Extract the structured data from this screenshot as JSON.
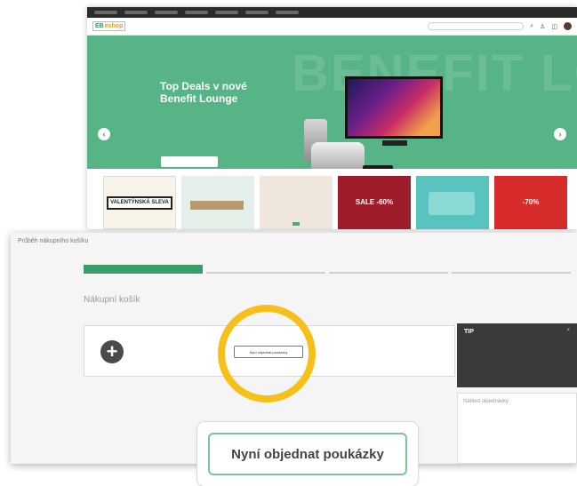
{
  "browser": {
    "tabs": [
      "",
      "",
      "",
      "",
      "",
      "",
      ""
    ],
    "logo": {
      "main": "EB",
      "accent": "eshop"
    },
    "nav_links": [
      "",
      "",
      "",
      "",
      "",
      ""
    ],
    "search_placeholder": ""
  },
  "hero": {
    "title_line1": "Top Deals v nové",
    "title_line2": "Benefit Lounge",
    "subtitle": "",
    "cta": "",
    "background_text": "BENEFIT LOUNGE",
    "prev_arrow": "‹",
    "next_arrow": "›",
    "accent_color": "#57b487"
  },
  "promo_tiles": [
    {
      "name": "valentine",
      "text": "VALENTÝNSKÁ SLEVA"
    },
    {
      "name": "shelf",
      "text": ""
    },
    {
      "name": "fashion",
      "text": ""
    },
    {
      "name": "sale",
      "text": "SALE -60%"
    },
    {
      "name": "teal",
      "text": ""
    },
    {
      "name": "discount",
      "text": "-70%"
    }
  ],
  "checkout": {
    "window_title": "Průběh nákupního košíku",
    "steps": [
      "",
      "",
      "",
      ""
    ],
    "active_step": 1,
    "cart_heading": "Nákupní košík",
    "column_left": "",
    "column_right": "",
    "add_icon": "plus-icon",
    "order_small_button": "Nyní objednat poukázky",
    "note": "",
    "tip": {
      "heading": "TIP",
      "close": "×",
      "text": ""
    },
    "summary": {
      "heading": "Náhled objednávky",
      "rows": [
        {
          "label": "",
          "value": ""
        },
        {
          "label": "",
          "value": ""
        },
        {
          "label": "",
          "value": ""
        }
      ]
    }
  },
  "highlight": {
    "ring_color": "#f6bf1a",
    "popup_button": "Nyní objednat poukázky",
    "popup_border_color": "#7cc59b"
  }
}
